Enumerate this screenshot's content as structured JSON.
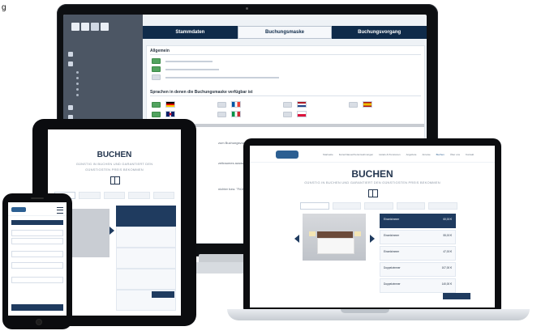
{
  "corner": {
    "text": "g"
  },
  "desktop": {
    "tabs": [
      "Stammdaten",
      "Buchungsmaske",
      "Buchungsvorgang"
    ],
    "sections": {
      "general_title": "Allgemein",
      "languages_title": "Sprachen in denen die Buchungsmaske verfügbar ist"
    },
    "text_snips": [
      "zum Buchungsvorgang zusätzlich gebucht werden können?",
      "zeitraumes auswahl soll der Hinweis \"Zu",
      "nichter bzw. \"Frühstück\" von einer"
    ]
  },
  "tablet": {
    "title": "BUCHEN",
    "subtitle_lines": [
      "GÜNSTIG IN BUCHEN UND GARANTIERT DEN",
      "GÜNSTIGSTEN PREIS BEKOMMEN"
    ]
  },
  "laptop": {
    "title": "BUCHEN",
    "subtitle": "GÜNSTIG IN BUCHEN UND GARANTIERT DEN GÜNSTIGSTEN PREIS BEKOMMEN",
    "logo": "tour-oe friends",
    "nav_items": [
      "Startseite",
      "Ferienhäuser/Ferienwohnungen",
      "Hotels & Pensionen",
      "Angebote",
      "Anreise",
      "Buchen",
      "Über uns",
      "Kontakt"
    ],
    "active_nav": "Buchen",
    "cards": [
      {
        "label": "Einzelzimmer",
        "price": "60,00 €"
      },
      {
        "label": "Einzelzimmer",
        "price": "55,00 €"
      },
      {
        "label": "Einzelzimmer",
        "price": "47,00 €"
      },
      {
        "label": "Doppelzimmer",
        "price": "107,00 €"
      },
      {
        "label": "Doppelzimmer",
        "price": "140,00 €"
      }
    ]
  },
  "phone": {
    "logo": "tour-oe",
    "cta": "Ihr Zielort"
  },
  "colors": {
    "navy": "#0f2b4a",
    "primary": "#1f3b5f",
    "accent_green": "#52a35f"
  }
}
